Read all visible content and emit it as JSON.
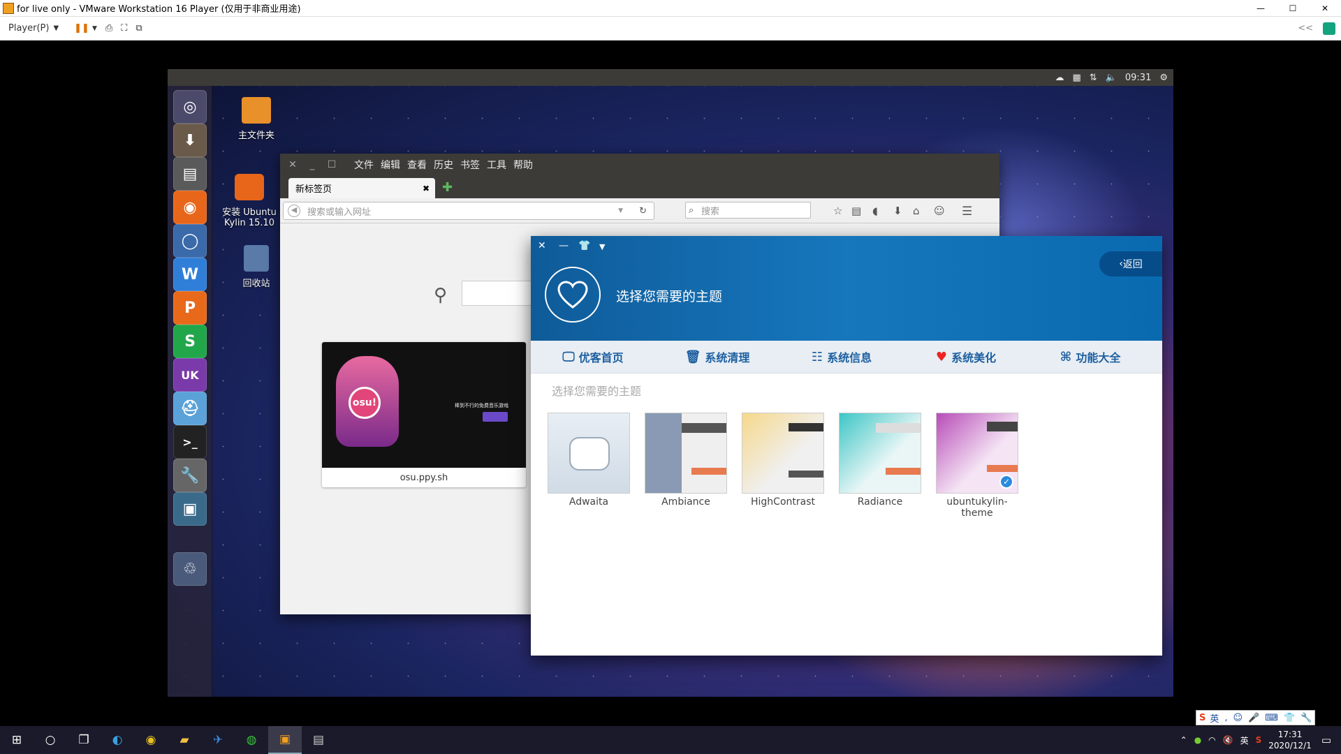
{
  "vmware": {
    "title": "for live only - VMware Workstation 16 Player (仅用于非商业用途)",
    "player_menu": "Player(P)",
    "collapse": "<<"
  },
  "guest": {
    "panel": {
      "time": "09:31"
    },
    "desktop_icons": [
      {
        "label": "主文件夹"
      },
      {
        "label": "安装 Ubuntu Kylin 15.10"
      },
      {
        "label": "回收站"
      }
    ],
    "launcher_labels": {
      "wps_writer": "W",
      "wps_presentation": "P",
      "wps_spreadsheet": "S",
      "ubuntukylin": "UK"
    }
  },
  "firefox": {
    "menu": [
      "文件",
      "编辑",
      "查看",
      "历史",
      "书签",
      "工具",
      "帮助"
    ],
    "tab_title": "新标签页",
    "url_placeholder": "搜索或输入网址",
    "search_placeholder": "搜索",
    "tile": {
      "label": "osu.ppy.sh",
      "thumb_text": "osu!",
      "thumb_caption": "棒到不行的免费音乐游戏"
    }
  },
  "kylin": {
    "title": "选择您需要的主题",
    "back": "返回",
    "nav": [
      {
        "label": "优客首页",
        "icon": "monitor-icon"
      },
      {
        "label": "系统清理",
        "icon": "trash-icon"
      },
      {
        "label": "系统信息",
        "icon": "list-icon"
      },
      {
        "label": "系统美化",
        "icon": "heart-icon"
      },
      {
        "label": "功能大全",
        "icon": "command-icon"
      }
    ],
    "subtitle": "选择您需要的主题",
    "themes": [
      {
        "name": "Adwaita"
      },
      {
        "name": "Ambiance"
      },
      {
        "name": "HighContrast"
      },
      {
        "name": "Radiance"
      },
      {
        "name": "ubuntukylin-theme"
      }
    ],
    "selected_theme": "ubuntukylin-theme"
  },
  "taskbar": {
    "ime_lang": "英",
    "tray_lang": "英",
    "time": "17:31",
    "date": "2020/12/1"
  },
  "colors": {
    "kylin_blue": "#1677bd",
    "ubuntu_panel": "#3c3b37"
  }
}
